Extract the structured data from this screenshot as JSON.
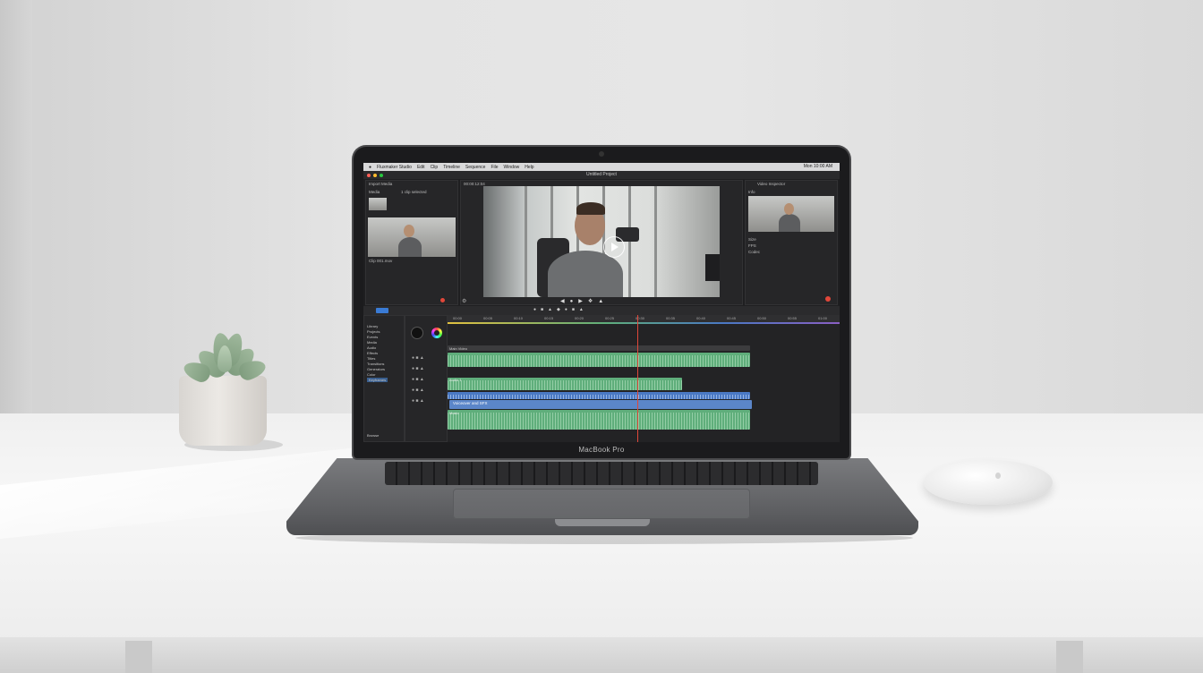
{
  "laptop": {
    "brand_label": "MacBook Pro"
  },
  "app": {
    "menu": [
      "Fluxmaker Studio",
      "Edit",
      "Clip",
      "Timeline",
      "Sequence",
      "File",
      "Window",
      "Help"
    ],
    "window_title": "Untitled Project",
    "status_time": "Mon 10:00 AM",
    "panels": {
      "media_title": "Import Media",
      "media_section": "Media",
      "media_meta": "1 clip selected",
      "media_caption": "Clip 001.mov",
      "viewer_label": "00:00:12:04",
      "inspector_title": "Video Inspector",
      "inspector_section": "Info",
      "inspector_rows": [
        "Size",
        "FPS",
        "Codec"
      ]
    },
    "sidebar_items": [
      "Library",
      "Projects",
      "Events",
      "Media",
      "Audio",
      "Effects",
      "Titles",
      "Transitions",
      "Generators",
      "Color",
      "Keyframes"
    ],
    "sidebar_footer": "Browse",
    "timeline": {
      "ticks": [
        "00:00",
        "00:05",
        "00:10",
        "00:15",
        "00:20",
        "00:25",
        "00:30",
        "00:35",
        "00:40",
        "00:45",
        "00:50",
        "00:55",
        "01:00"
      ],
      "tracks": [
        "Main Video",
        "Audio 1",
        "Music",
        "Voiceover and SFX"
      ]
    }
  },
  "colors": {
    "accent": "#3a7bd5",
    "audio_green": "#5fae7b",
    "audio_blue": "#4a79c4",
    "playhead": "#e0473a"
  }
}
